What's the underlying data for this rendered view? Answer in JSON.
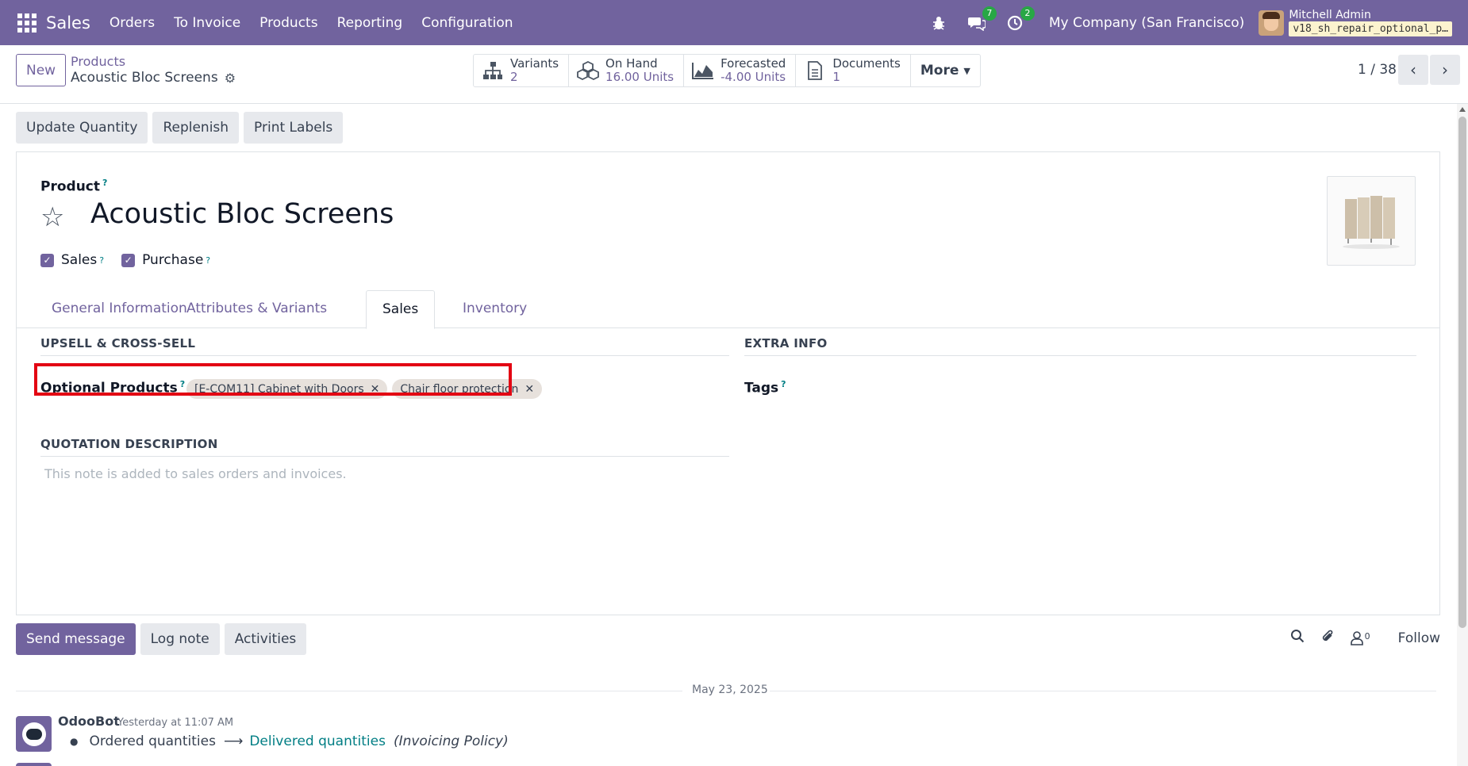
{
  "navbar": {
    "brand": "Sales",
    "menu": [
      "Orders",
      "To Invoice",
      "Products",
      "Reporting",
      "Configuration"
    ],
    "chat_badge": "7",
    "activity_badge": "2",
    "company": "My Company (San Francisco)",
    "user": "Mitchell Admin",
    "database": "v18_sh_repair_optional_p…"
  },
  "control": {
    "new_label": "New",
    "breadcrumb_parent": "Products",
    "breadcrumb_current": "Acoustic Bloc Screens",
    "stats": [
      {
        "label": "Variants",
        "value": "2"
      },
      {
        "label": "On Hand",
        "value": "16.00 Units"
      },
      {
        "label": "Forecasted",
        "value": "-4.00 Units"
      },
      {
        "label": "Documents",
        "value": "1"
      }
    ],
    "more_label": "More",
    "pager": "1 / 38"
  },
  "actions": [
    "Update Quantity",
    "Replenish",
    "Print Labels"
  ],
  "form": {
    "product_label": "Product",
    "name": "Acoustic Bloc Screens",
    "sales_label": "Sales",
    "purchase_label": "Purchase",
    "tabs": [
      "General Information",
      "Attributes & Variants",
      "Sales",
      "Inventory"
    ],
    "active_tab": "Sales",
    "upsell_title": "UPSELL & CROSS-SELL",
    "optional_products_label": "Optional Products",
    "optional_products": [
      "[E-COM11] Cabinet with Doors",
      "Chair floor protection"
    ],
    "extra_info_title": "EXTRA INFO",
    "tags_label": "Tags",
    "quotation_title": "QUOTATION DESCRIPTION",
    "quotation_placeholder": "This note is added to sales orders and invoices."
  },
  "chatter": {
    "send_message": "Send message",
    "log_note": "Log note",
    "activities": "Activities",
    "followers_count": "0",
    "follow_label": "Follow",
    "date": "May 23, 2025",
    "author": "OdooBot",
    "time": "Yesterday at 11:07 AM",
    "old_value": "Ordered quantities",
    "new_value": "Delivered quantities",
    "field": "(Invoicing Policy)"
  },
  "colors": {
    "brand": "#71639e",
    "link": "#017e84",
    "highlight": "#e30613"
  }
}
